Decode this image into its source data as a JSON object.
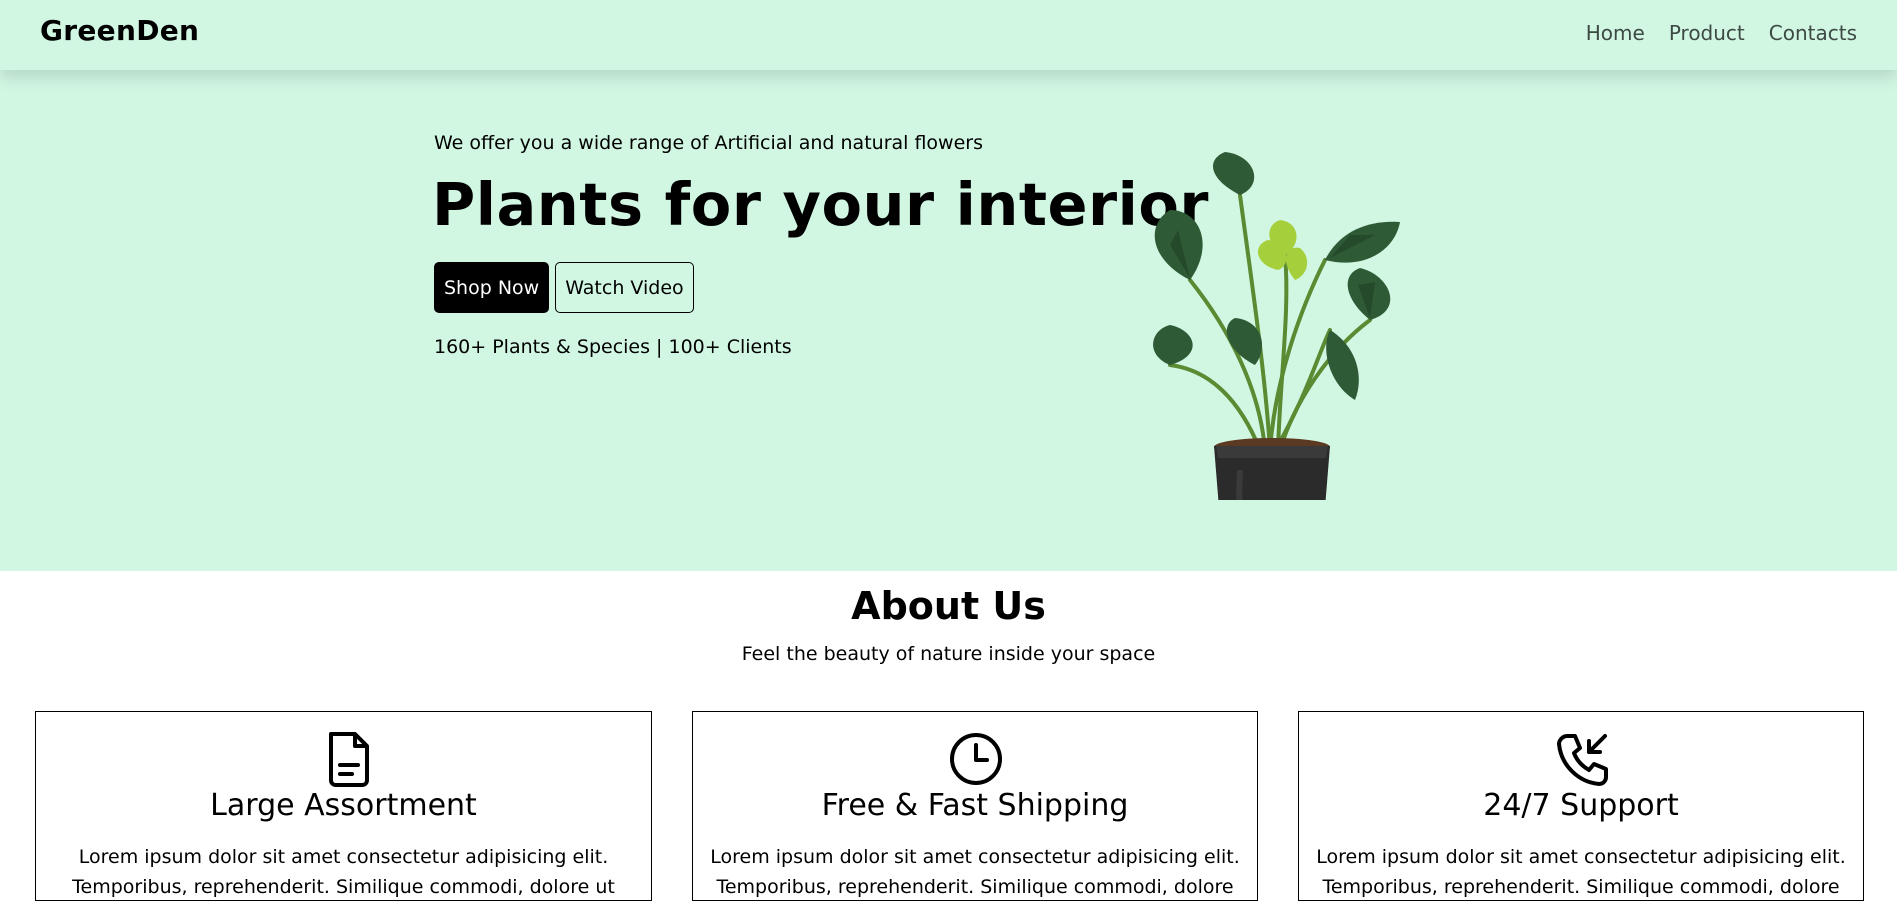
{
  "navbar": {
    "brand": "GreenDen",
    "links": [
      "Home",
      "Product",
      "Contacts"
    ]
  },
  "hero": {
    "tagline": "We offer you a wide range of Artificial and natural flowers",
    "title": "Plants for your interior",
    "shop_button": "Shop Now",
    "video_button": "Watch Video",
    "stats": "160+ Plants & Species | 100+ Clients"
  },
  "about": {
    "title": "About Us",
    "subtitle": "Feel the beauty of nature inside your space",
    "cards": [
      {
        "icon": "document-icon",
        "title": "Large Assortment",
        "text": "Lorem ipsum dolor sit amet consectetur adipisicing elit. Temporibus, reprehenderit. Similique commodi, dolore ut itaque quos."
      },
      {
        "icon": "clock-icon",
        "title": "Free & Fast Shipping",
        "text": "Lorem ipsum dolor sit amet consectetur adipisicing elit. Temporibus, reprehenderit. Similique commodi, dolore ut itaque quos."
      },
      {
        "icon": "phone-incoming-icon",
        "title": "24/7 Support",
        "text": "Lorem ipsum dolor sit amet consectetur adipisicing elit. Temporibus, reprehenderit. Similique commodi, dolore ut itaque quos."
      }
    ]
  },
  "colors": {
    "mint_background": "#d1f7e3",
    "primary_button": "#000000",
    "nav_text": "#3d4a44"
  }
}
